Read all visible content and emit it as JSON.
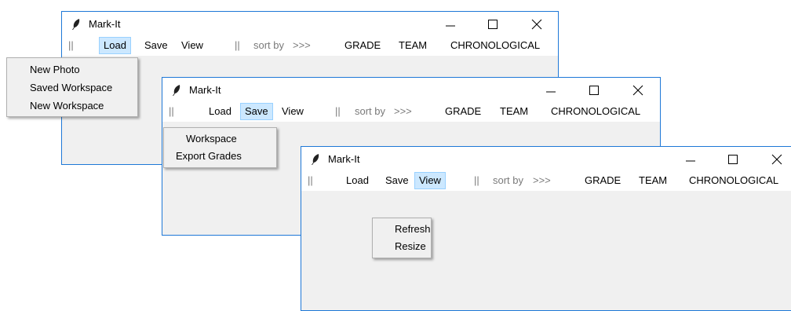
{
  "windows": [
    {
      "title": "Mark-It",
      "menu": {
        "sep1": "||",
        "load": "Load",
        "save": "Save",
        "view": "View",
        "sep2": "||",
        "sortby": "sort by",
        "arrows": ">>>",
        "grade": "GRADE",
        "team": "TEAM",
        "chrono": "CHRONOLOGICAL"
      },
      "active_menu": "Load",
      "dropdown": [
        "New Photo",
        "Saved Workspace",
        "New Workspace"
      ]
    },
    {
      "title": "Mark-It",
      "menu": {
        "sep1": "||",
        "load": "Load",
        "save": "Save",
        "view": "View",
        "sep2": "||",
        "sortby": "sort by",
        "arrows": ">>>",
        "grade": "GRADE",
        "team": "TEAM",
        "chrono": "CHRONOLOGICAL"
      },
      "active_menu": "Save",
      "dropdown": [
        "Workspace",
        "Export Grades"
      ]
    },
    {
      "title": "Mark-It",
      "menu": {
        "sep1": "||",
        "load": "Load",
        "save": "Save",
        "view": "View",
        "sep2": "||",
        "sortby": "sort by",
        "arrows": ">>>",
        "grade": "GRADE",
        "team": "TEAM",
        "chrono": "CHRONOLOGICAL"
      },
      "active_menu": "View",
      "dropdown": [
        "Refresh",
        "Resize"
      ]
    }
  ],
  "icons": {
    "app": "feather-icon",
    "minimize": "minimize-icon",
    "maximize": "maximize-icon",
    "close": "close-icon"
  },
  "colors": {
    "window_border": "#1e78d7",
    "active_menu_bg": "#cce8ff",
    "active_menu_border": "#99d1ff",
    "client_bg": "#f0f0f0"
  }
}
